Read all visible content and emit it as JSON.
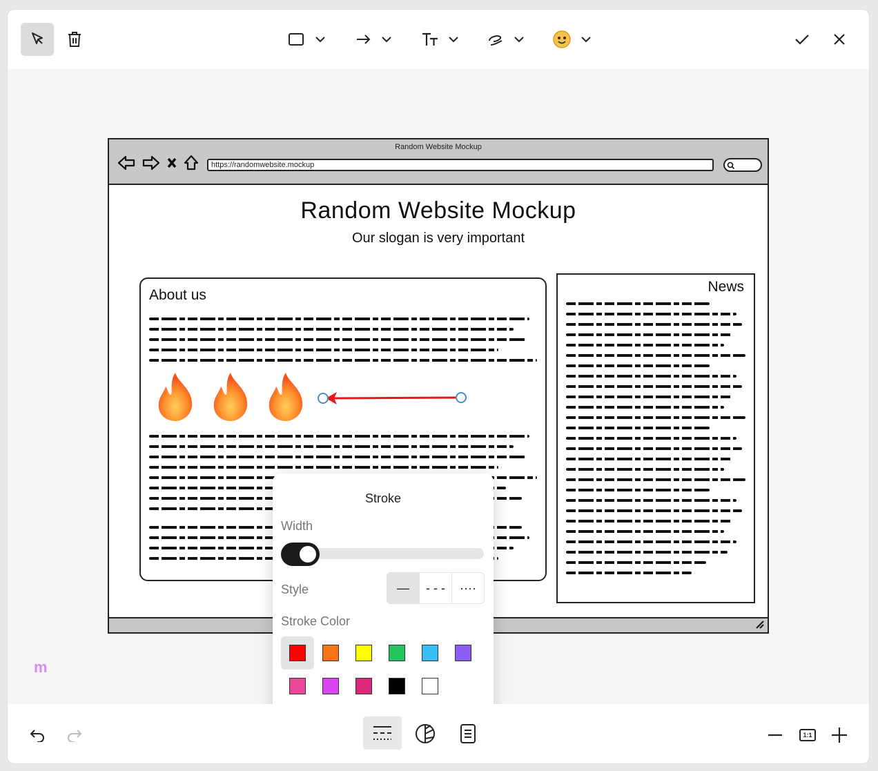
{
  "toolbar": {
    "tools": [
      {
        "icon": "cursor-icon",
        "label": "select"
      },
      {
        "icon": "trash-icon",
        "label": "delete"
      },
      {
        "icon": "rectangle-icon",
        "label": "shape"
      },
      {
        "icon": "arrow-icon",
        "label": "arrow"
      },
      {
        "icon": "text-size-icon",
        "label": "text"
      },
      {
        "icon": "highlighter-icon",
        "label": "pen"
      },
      {
        "icon": "emoji-icon",
        "label": "sticker"
      }
    ],
    "confirm_icon": "check-icon",
    "close_icon": "close-icon"
  },
  "mockup": {
    "window_title": "Random Website Mockup",
    "url": "https://randomwebsite.mockup",
    "site_title": "Random Website Mockup",
    "slogan": "Our slogan is very important",
    "about_title": "About us",
    "news_title": "News"
  },
  "stroke_panel": {
    "title": "Stroke",
    "width_label": "Width",
    "style_label": "Style",
    "style_options": [
      "—",
      "- - -",
      "····"
    ],
    "selected_style": 0,
    "color_label": "Stroke Color",
    "colors": [
      "#ff0000",
      "#f97316",
      "#ffff00",
      "#22c55e",
      "#38bdf8",
      "#8b5cf6",
      "#ec4899",
      "#d946ef",
      "#db2777",
      "#000000",
      "#ffffff"
    ],
    "selected_color": "#ff0000"
  },
  "annotation": {
    "arrow_color": "#e8161d"
  },
  "bottombar": {
    "undo_icon": "undo-icon",
    "redo_icon": "redo-icon",
    "stroke_icon": "stroke-style-icon",
    "opacity_icon": "contrast-icon",
    "notes_icon": "notes-icon",
    "zoom_out_icon": "minus-icon",
    "zoom_reset_label": "1:1",
    "zoom_in_icon": "plus-icon"
  },
  "brand": {
    "logo_text": "m"
  }
}
